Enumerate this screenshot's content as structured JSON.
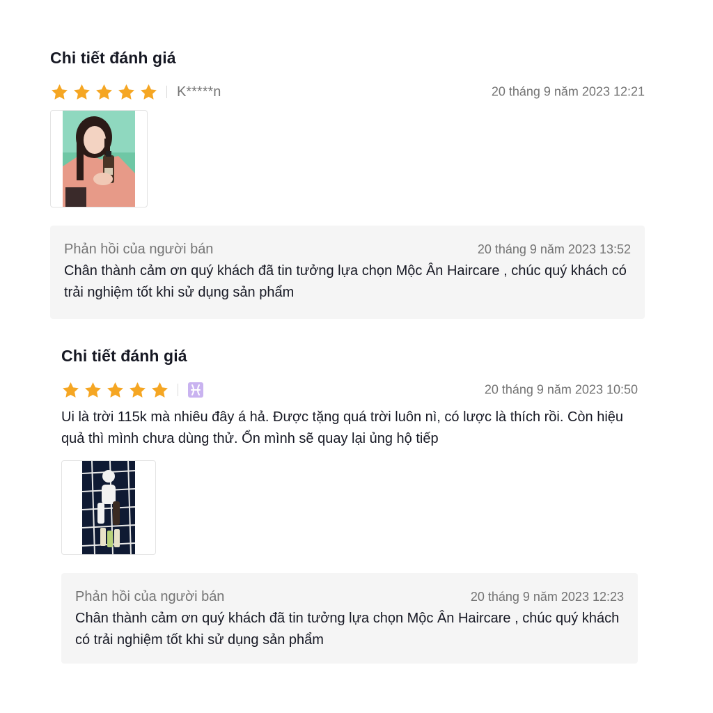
{
  "reviews": [
    {
      "section_title": "Chi tiết đánh giá",
      "rating": 5,
      "username": "K*****n",
      "timestamp": "20 tháng 9 năm 2023 12:21",
      "text": "",
      "image_icon": "photo-woman-holding-bottle",
      "reply": {
        "label": "Phản hồi của người bán",
        "timestamp": "20 tháng 9 năm 2023 13:52",
        "text": "Chân thành cảm ơn quý khách đã tin tưởng lựa chọn Mộc Ân Haircare , chúc quý khách có trải nghiệm tốt khi sử dụng sản phẩm"
      }
    },
    {
      "section_title": "Chi tiết đánh giá",
      "rating": 5,
      "username_icon": "pisces-zodiac-icon",
      "timestamp": "20 tháng 9 năm 2023 10:50",
      "text": "Ui là trời 115k mà nhiêu đây á hả. Được tặng quá trời luôn nì, có lược là thích rồi. Còn hiệu quả thì mình chưa dùng thử. Ổn mình sẽ quay lại ủng hộ tiếp",
      "image_icon": "photo-products-on-grid",
      "reply": {
        "label": "Phản hồi của người bán",
        "timestamp": "20 tháng 9 năm 2023 12:23",
        "text": "Chân thành cảm ơn quý khách đã tin tưởng lựa chọn Mộc Ân Haircare , chúc quý khách có trải nghiệm tốt khi sử dụng sản phẩm"
      }
    }
  ],
  "colors": {
    "star": "#F5A623",
    "reply_bg": "#F5F5F5",
    "muted_text": "#757575",
    "pisces_badge": "#C9B3F0"
  }
}
